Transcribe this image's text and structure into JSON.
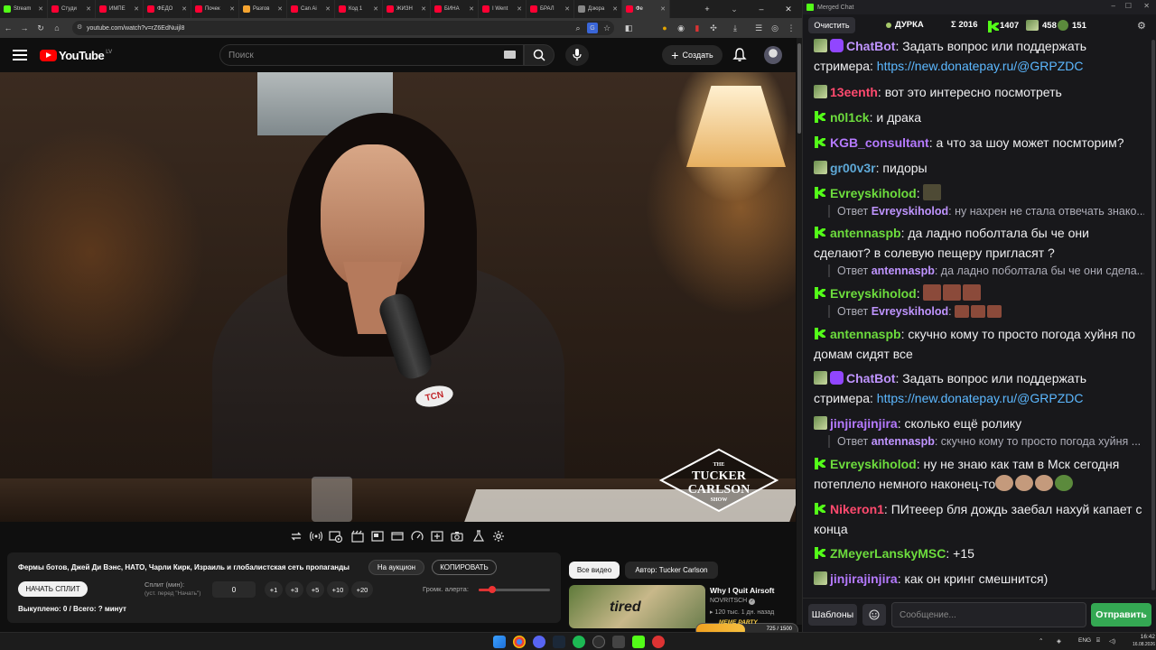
{
  "browser": {
    "tabs": [
      {
        "label": "Stream",
        "color": "#53fc18",
        "active": false
      },
      {
        "label": "Студи",
        "color": "#ff0033",
        "active": false
      },
      {
        "label": "ИМПЕ",
        "color": "#ff0033",
        "active": false
      },
      {
        "label": "ФЕДО",
        "color": "#ff0033",
        "active": false
      },
      {
        "label": "Почек",
        "color": "#ff0033",
        "active": false
      },
      {
        "label": "Разгов",
        "color": "#f4a430",
        "active": false
      },
      {
        "label": "Can Ai",
        "color": "#ff0033",
        "active": false
      },
      {
        "label": "Код 1",
        "color": "#ff0033",
        "active": false
      },
      {
        "label": "ЖИЗН",
        "color": "#ff0033",
        "active": false
      },
      {
        "label": "БИНА",
        "color": "#ff0033",
        "active": false
      },
      {
        "label": "I Went",
        "color": "#ff0033",
        "active": false
      },
      {
        "label": "БРАЛ",
        "color": "#ff0033",
        "active": false
      },
      {
        "label": "Дзюра",
        "color": "#888888",
        "active": false
      },
      {
        "label": "Фе",
        "color": "#ff0033",
        "active": true
      }
    ],
    "url": "youtube.com/watch?v=rZ6EdNuijl8"
  },
  "youtube": {
    "logo_text": "YouTube",
    "country_code": "LV",
    "search_placeholder": "Поиск",
    "create_label": "Создать"
  },
  "video": {
    "logo_lines": [
      "THE",
      "TUCKER",
      "CARLSON",
      "SHOW"
    ],
    "mic_badge": "TCN"
  },
  "panel": {
    "title": "Фермы ботов, Джей Ди Вэнс, НАТО, Чарли Кирк, Израиль и глобалистская сеть пропаганды",
    "auction_label": "На аукцион",
    "copy_label": "КОПИРОВАТЬ",
    "start_split_label": "НАЧАТЬ СПЛИТ",
    "split_label": "Сплит (мин):",
    "split_hint": "(уст. перед \"Начать\")",
    "split_value": "0",
    "steps": [
      "+1",
      "+3",
      "+5",
      "+10",
      "+20"
    ],
    "alert_label": "Громк. алерта:",
    "alert_volume": 0.15,
    "bought_text": "Выкуплено: 0 / Всего: ? минут"
  },
  "related": {
    "tab_all": "Все видео",
    "tab_author": "Автор: Tucker Carlson",
    "thumb_text": "tired",
    "video_title": "Why I Quit Airsoft",
    "channel": "NOVRITSCH",
    "meta": "120 тыс.  1 дн. назад"
  },
  "overlay": {
    "meme_label": "MEME PARTY",
    "meme_count": "725 / 1500",
    "meme_progress": 0.48
  },
  "taskbar": {
    "lang": "ENG",
    "time": "16:42",
    "date": "16.08.2026"
  },
  "chat": {
    "window_title": "Merged Chat",
    "clear_label": "Очистить",
    "stream_name": "ДУРКА",
    "total": "Σ 2016",
    "kick_count": "1407",
    "twitch_count": "458",
    "other_count": "151",
    "templates_label": "Шаблоны",
    "input_placeholder": "Сообщение...",
    "send_label": "Отправить",
    "messages": [
      {
        "badge": "tw-bot",
        "nick": "ChatBot",
        "color": "#bf94ff",
        "text": ": Задать вопрос или поддержать стримера: ",
        "link": "https://new.donatepay.ru/@GRPZDC"
      },
      {
        "badge": "tw",
        "nick": "13eenth",
        "color": "#ff4a6e",
        "text": ": вот это интересно посмотреть"
      },
      {
        "badge": "kick",
        "nick": "n0l1ck",
        "color": "#6ddc3d",
        "text": ": и драка"
      },
      {
        "badge": "kick",
        "nick": "KGB_consultant",
        "color": "#b57aff",
        "text": ": а что за шоу может посмторим?"
      },
      {
        "badge": "tw",
        "nick": "gr00v3r",
        "color": "#5ea8d6",
        "text": ": пидоры"
      },
      {
        "badge": "kick",
        "nick": "Evreyskiholod",
        "color": "#6ddc3d",
        "text": ": "
      },
      {
        "badge": "kick",
        "nick": "antennaspb",
        "color": "#6ddc3d",
        "text": ": да ладно поболтала бы че они сделают? в солевую пещеру пригласят ?"
      },
      {
        "badge": "kick",
        "nick": "Evreyskiholod",
        "color": "#6ddc3d",
        "text": ": "
      },
      {
        "badge": "kick",
        "nick": "antennaspb",
        "color": "#6ddc3d",
        "text": ": скучно кому то просто погода хуйня по домам сидят все"
      },
      {
        "badge": "tw-bot",
        "nick": "ChatBot",
        "color": "#bf94ff",
        "text": ": Задать вопрос или поддержать стримера: ",
        "link": "https://new.donatepay.ru/@GRPZDC"
      },
      {
        "badge": "tw",
        "nick": "jinjirajinjira",
        "color": "#b57aff",
        "text": ": сколько ещё ролику"
      },
      {
        "badge": "kick",
        "nick": "Evreyskiholod",
        "color": "#6ddc3d",
        "text": ": ну не знаю как там в Мск сегодня потеплело немного наконец-то"
      },
      {
        "badge": "kick",
        "nick": "Nikeron1",
        "color": "#ff4a6e",
        "text": ": ПИтееер бля дождь заебал нахуй капает с конца"
      },
      {
        "badge": "kick",
        "nick": "ZMeyerLanskyMSC",
        "color": "#6ddc3d",
        "text": ": +15"
      },
      {
        "badge": "tw",
        "nick": "jinjirajinjira",
        "color": "#b57aff",
        "text": ": как он кринг смешнится)"
      }
    ],
    "replies": [
      {
        "prefix": "Ответ ",
        "nick": "Evreyskiholod",
        "text": ": ну нахрен не стала отвечать знако..."
      },
      {
        "prefix": "Ответ ",
        "nick": "antennaspb",
        "text": ": да ладно поболтала бы че они сдела..."
      },
      {
        "prefix": "Ответ ",
        "nick": "Evreyskiholod",
        "text": ": "
      },
      {
        "prefix": "Ответ ",
        "nick": "antennaspb",
        "text": ": скучно кому то просто погода хуйня ..."
      }
    ]
  }
}
